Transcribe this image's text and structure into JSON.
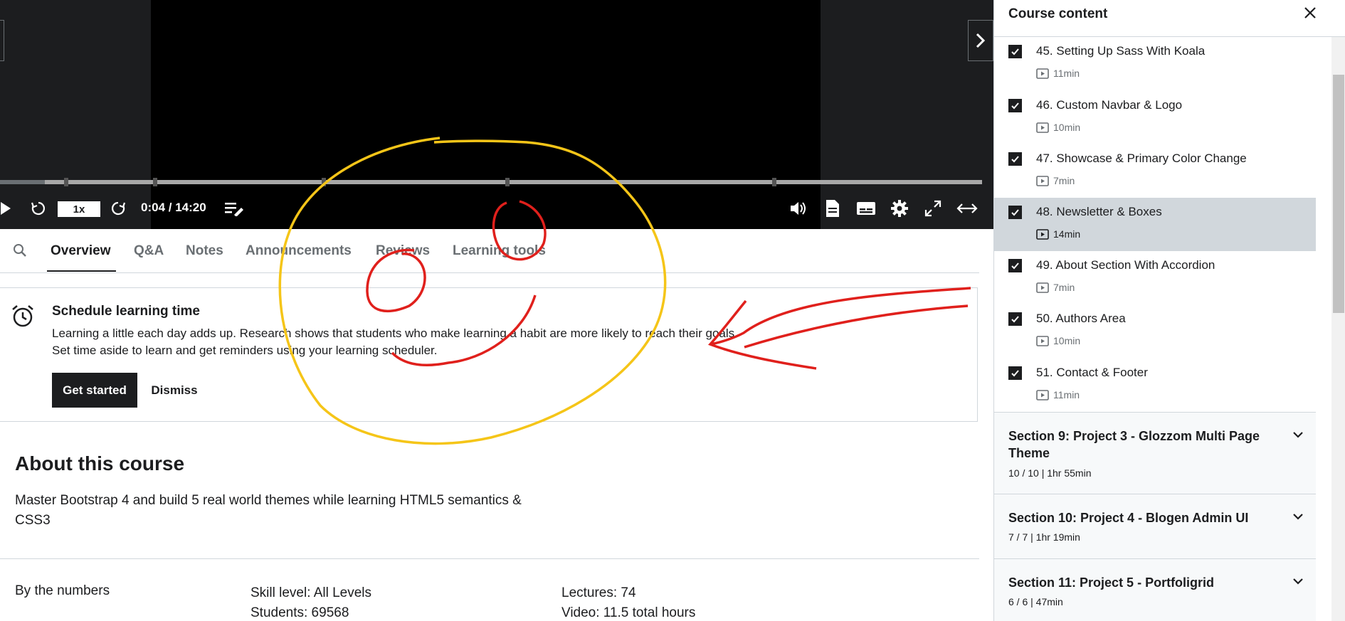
{
  "player": {
    "speed": "1x",
    "time": "0:04 / 14:20",
    "progress_fraction": 0.046
  },
  "tabs": [
    {
      "label": "Overview"
    },
    {
      "label": "Q&A"
    },
    {
      "label": "Notes"
    },
    {
      "label": "Announcements"
    },
    {
      "label": "Reviews"
    },
    {
      "label": "Learning tools"
    }
  ],
  "schedule": {
    "title": "Schedule learning time",
    "line1": "Learning a little each day adds up. Research shows that students who make learning a habit are more likely to reach their goals.",
    "line2": "Set time aside to learn and get reminders using your learning scheduler.",
    "primary_label": "Get started",
    "dismiss_label": "Dismiss"
  },
  "about": {
    "title": "About this course",
    "description": "Master Bootstrap 4 and build 5 real world themes while learning HTML5 semantics & CSS3",
    "numbers_label": "By the numbers",
    "skill": "Skill level: All Levels",
    "students": "Students: 69568",
    "lectures": "Lectures: 74",
    "video": "Video: 11.5 total hours"
  },
  "sidebar": {
    "title": "Course content",
    "lectures": [
      {
        "title": "45. Setting Up Sass With Koala",
        "duration": "11min"
      },
      {
        "title": "46. Custom Navbar & Logo",
        "duration": "10min"
      },
      {
        "title": "47. Showcase & Primary Color Change",
        "duration": "7min"
      },
      {
        "title": "48. Newsletter & Boxes",
        "duration": "14min"
      },
      {
        "title": "49. About Section With Accordion",
        "duration": "7min"
      },
      {
        "title": "50. Authors Area",
        "duration": "10min"
      },
      {
        "title": "51. Contact & Footer",
        "duration": "11min"
      }
    ],
    "sections": [
      {
        "title": "Section 9: Project 3 - Glozzom Multi Page Theme",
        "meta": "10 / 10 | 1hr 55min"
      },
      {
        "title": "Section 10: Project 4 - Blogen Admin UI",
        "meta": "7 / 7 | 1hr 19min"
      },
      {
        "title": "Section 11: Project 5 - Portfoligrid",
        "meta": "6 / 6 | 47min"
      }
    ]
  },
  "colors": {
    "dark": "#1c1d1f",
    "muted": "#6a6f73",
    "border": "#d1d7dc",
    "annotation_yellow": "#f5c518",
    "annotation_red": "#e0201c"
  }
}
